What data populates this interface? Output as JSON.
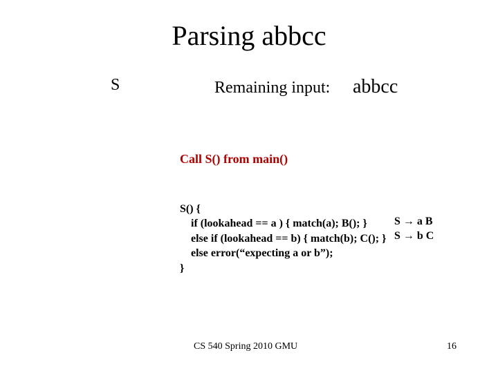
{
  "title": "Parsing abbcc",
  "tree": {
    "root": "S"
  },
  "remaining": {
    "label": "Remaining input:",
    "value": "abbcc"
  },
  "call_line": "Call S() from main()",
  "code": {
    "l1": "S() {",
    "l2": "    if (lookahead == a ) { match(a); B(); }",
    "l3": "    else if (lookahead == b) { match(b); C(); }",
    "l4": "    else error(“expecting a or b”);",
    "l5": "}"
  },
  "grammar": {
    "r1": "S → a B",
    "r2": "S → b C"
  },
  "footer": {
    "course": "CS 540 Spring 2010 GMU",
    "page": "16"
  }
}
